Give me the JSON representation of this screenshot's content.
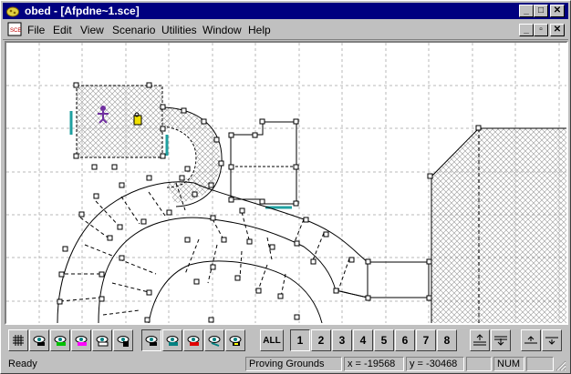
{
  "window": {
    "title": "obed - [Afpdne~1.sce]",
    "controls": {
      "minimize": "_",
      "maximize": "□",
      "close": "✕"
    }
  },
  "menu": {
    "items": [
      "File",
      "Edit",
      "View",
      "Scenario",
      "Utilities",
      "Window",
      "Help"
    ],
    "mdi_controls": {
      "minimize": "_",
      "restore": "▫",
      "close": "✕"
    }
  },
  "toolbar": {
    "icons": [
      "new-icon",
      "open-icon",
      "save-icon",
      "cut-icon",
      "copy-icon",
      "paste-icon",
      "print-icon",
      "help-icon",
      "select-arrow-icon",
      "rotate-icon",
      "triangle-tool-icon",
      "wheel-tool-icon",
      "hammer-icon",
      "corner-tool-icon",
      "curve-tool-icon",
      "light-icon",
      "hand-icon",
      "zoom-in-icon",
      "zoom-out-icon",
      "crosshair-icon",
      "snowflake-icon",
      "query-icon",
      "fullscreen-icon"
    ]
  },
  "bottom_toolbar": {
    "all_label": "ALL",
    "layer_numbers": [
      "1",
      "2",
      "3",
      "4",
      "5",
      "6",
      "7",
      "8"
    ]
  },
  "status": {
    "ready": "Ready",
    "map_name": "Proving Grounds",
    "x_label": "x =",
    "x_value": "-19568",
    "y_label": "y =",
    "y_value": "-30468",
    "num": "NUM"
  },
  "colors": {
    "title_bar": "#000080",
    "face": "#c0c0c0",
    "canvas": "#ffffff",
    "grid": "#b0b0b0",
    "teal_line": "#20a0a0"
  }
}
